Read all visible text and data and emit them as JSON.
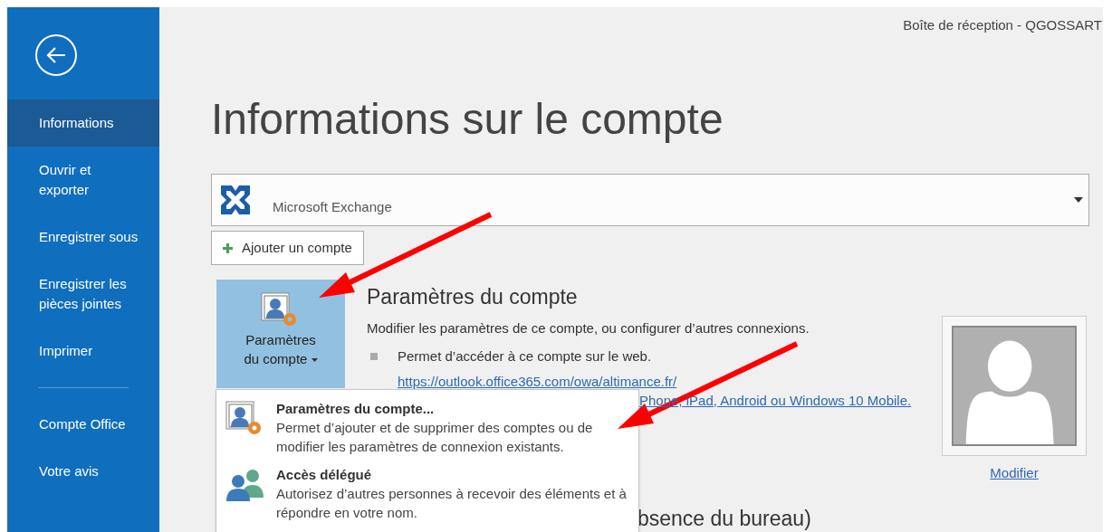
{
  "window": {
    "title": "Boîte de réception - QGOSSART"
  },
  "sidebar": {
    "items": [
      {
        "label": "Informations",
        "selected": true
      },
      {
        "label": "Ouvrir et exporter",
        "selected": false
      },
      {
        "label": "Enregistrer sous",
        "selected": false
      },
      {
        "label": "Enregistrer les pièces jointes",
        "selected": false
      },
      {
        "label": "Imprimer",
        "selected": false
      }
    ],
    "bottom_items": [
      {
        "label": "Compte Office",
        "selected": false
      },
      {
        "label": "Votre avis",
        "selected": false
      }
    ]
  },
  "page_title": "Informations sur le compte",
  "account_selector": {
    "account_type": "Microsoft Exchange"
  },
  "add_account_button": "Ajouter un compte",
  "account_settings": {
    "button_label": "Paramètres du compte",
    "heading": "Paramètres du compte",
    "description": "Modifier les paramètres de ce compte, ou configurer d’autres connexions.",
    "bullet": "Permet d’accéder à ce compte sur le web.",
    "link": "https://outlook.office365.com/owa/altimance.fr/",
    "link_2": "Phone, iPad, Android ou Windows 10 Mobile."
  },
  "profile_picture": {
    "change_link": "Modifier"
  },
  "next_section_heading": "bsence du bureau)",
  "dropdown_menu": [
    {
      "kind": "settings",
      "title": "Paramètres du compte...",
      "description": "Permet d’ajouter et de supprimer des comptes ou de modifier les paramètres de connexion existants."
    },
    {
      "kind": "delegate",
      "title": "Accès délégué",
      "description": "Autorisez d’autres personnes à recevoir des éléments et à répondre en votre nom."
    }
  ]
}
